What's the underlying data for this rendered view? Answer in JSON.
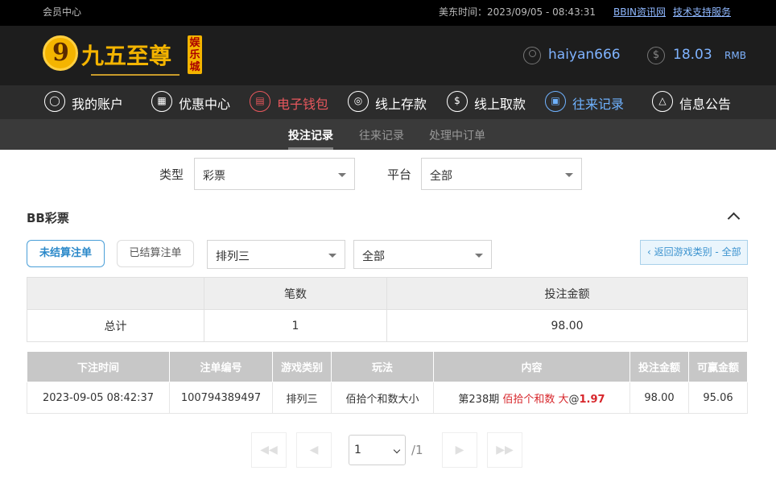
{
  "topbar": {
    "member_center": "会员中心",
    "time_label": "美东时间：2023/09/05 - 08:43:31",
    "link1": "BBIN资讯网",
    "link2": "技术支持服务"
  },
  "header": {
    "logo_icon": "9",
    "logo_title": "九五至尊",
    "logo_tag": "娱乐城",
    "username": "haiyan666",
    "balance": "18.03",
    "currency": "RMB"
  },
  "nav": {
    "items": [
      {
        "label": "我的账户",
        "icon": "user-icon"
      },
      {
        "label": "优惠中心",
        "icon": "gift-icon"
      },
      {
        "label": "电子钱包",
        "icon": "wallet-icon"
      },
      {
        "label": "线上存款",
        "icon": "deposit-icon"
      },
      {
        "label": "线上取款",
        "icon": "withdraw-icon"
      },
      {
        "label": "往来记录",
        "icon": "record-icon"
      },
      {
        "label": "信息公告",
        "icon": "bell-icon"
      }
    ]
  },
  "subnav": {
    "tabs": [
      "投注记录",
      "往来记录",
      "处理中订单"
    ],
    "active": "投注记录"
  },
  "filters": {
    "type_label": "类型",
    "type_value": "彩票",
    "platform_label": "平台",
    "platform_value": "全部"
  },
  "section": {
    "title": "BB彩票",
    "btn_unsettled": "未结算注单",
    "btn_settled": "已结算注单",
    "game_value": "排列三",
    "sub_value": "全部",
    "back_label": "‹ 返回游戏类别 - 全部"
  },
  "summary": {
    "headers": [
      "",
      "笔数",
      "投注金额"
    ],
    "row": [
      "总计",
      "1",
      "98.00"
    ]
  },
  "detail": {
    "headers": [
      "下注时间",
      "注单编号",
      "游戏类别",
      "玩法",
      "内容",
      "投注金额",
      "可赢金额"
    ],
    "row": {
      "time": "2023-09-05 08:42:37",
      "id": "100794389497",
      "game": "排列三",
      "play": "佰拾个和数大小",
      "content_prefix": "第238期 ",
      "content_bet": "佰拾个和数 大",
      "content_at": "@",
      "content_odds": "1.97",
      "bet": "98.00",
      "win": "95.06"
    }
  },
  "pagination": {
    "current": "1",
    "total": "/1",
    "first": "◀◀",
    "prev": "◀",
    "next": "▶",
    "last": "▶▶"
  },
  "colors": {
    "accent_blue": "#2a88c9",
    "red": "#d7262b",
    "gold": "#f4b400"
  }
}
